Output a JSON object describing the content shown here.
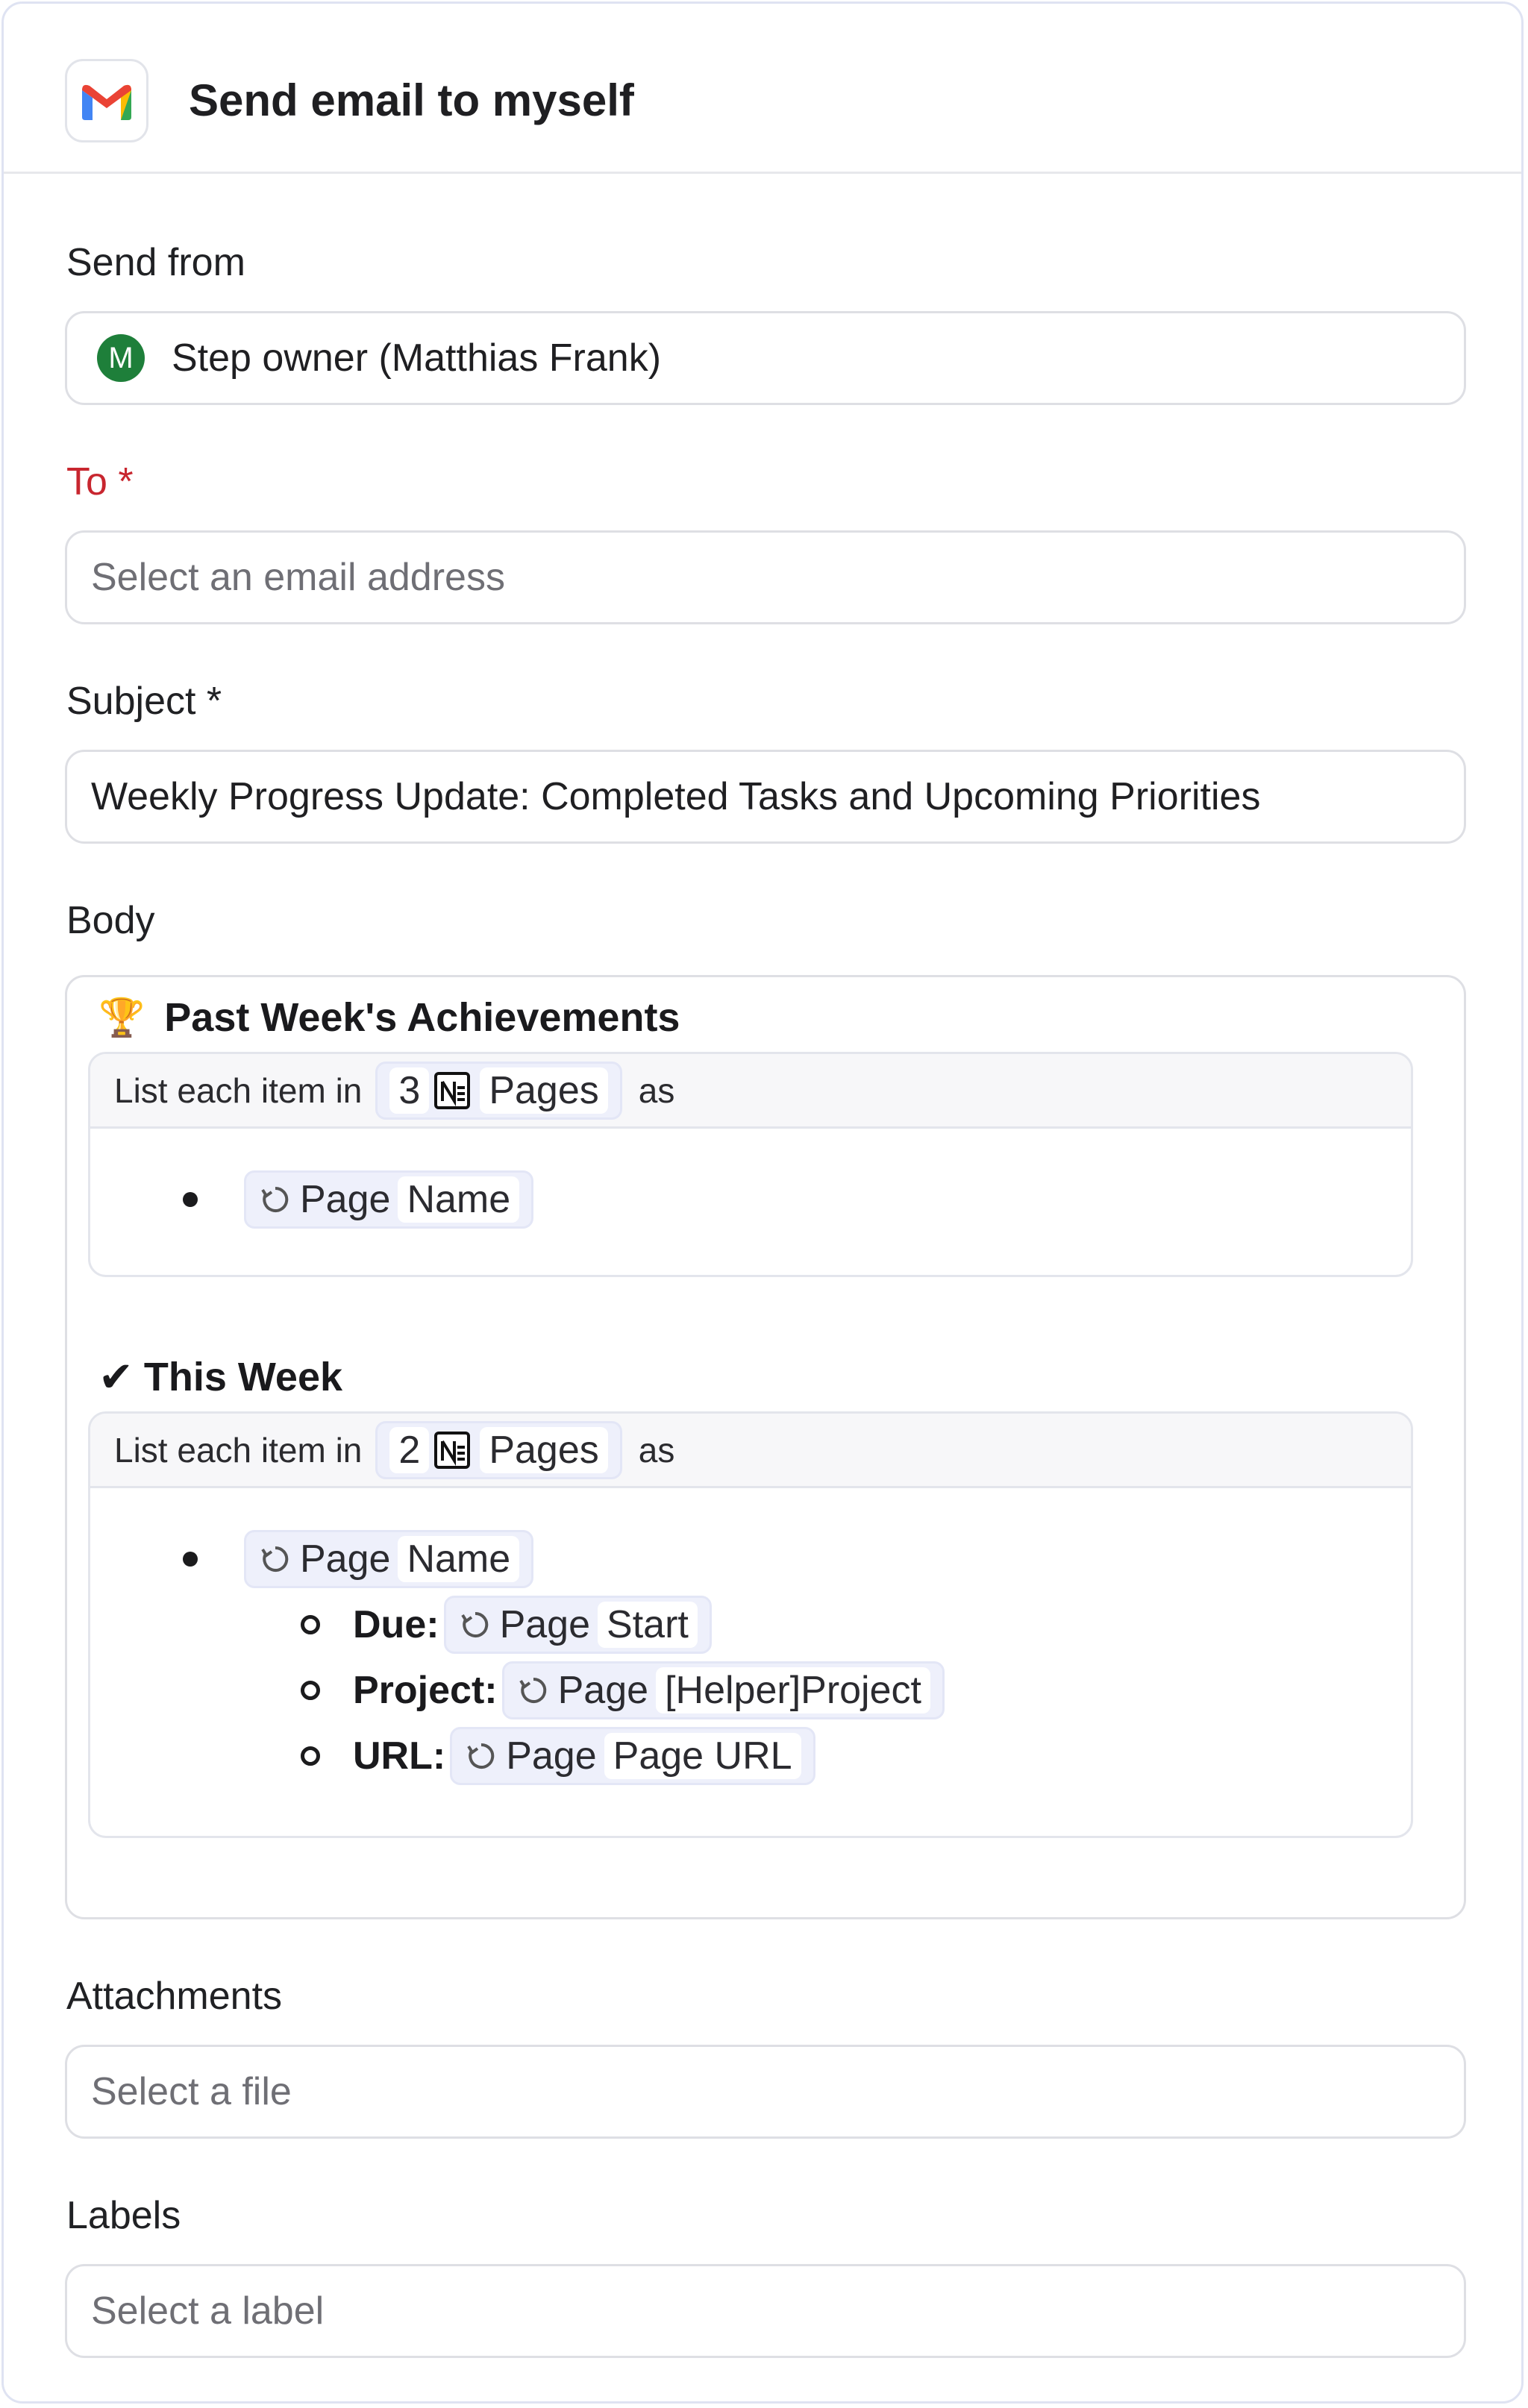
{
  "header": {
    "title": "Send email to myself",
    "app_icon": "gmail-icon"
  },
  "send_from": {
    "label": "Send from",
    "avatar_initial": "M",
    "value": "Step owner (Matthias Frank)"
  },
  "to": {
    "label": "To *",
    "placeholder": "Select an email address"
  },
  "subject": {
    "label": "Subject *",
    "value": "Weekly Progress Update: Completed Tasks and Upcoming Priorities"
  },
  "body": {
    "label": "Body",
    "sections": [
      {
        "emoji": "🏆",
        "heading": "Past Week's Achievements",
        "loop": {
          "prefix": "List each item in",
          "count": "3",
          "source": "Pages",
          "suffix": "as"
        },
        "item": {
          "var": "Page",
          "field": "Name"
        }
      },
      {
        "emoji": "✔",
        "heading": "This Week",
        "loop": {
          "prefix": "List each item in",
          "count": "2",
          "source": "Pages",
          "suffix": "as"
        },
        "item": {
          "var": "Page",
          "field": "Name"
        },
        "subitems": [
          {
            "label": "Due:",
            "var": "Page",
            "field": "Start"
          },
          {
            "label": "Project:",
            "var": "Page",
            "field": "[Helper]Project"
          },
          {
            "label": "URL:",
            "var": "Page",
            "field": "Page URL"
          }
        ]
      }
    ]
  },
  "attachments": {
    "label": "Attachments",
    "placeholder": "Select a file"
  },
  "labels": {
    "label": "Labels",
    "placeholder": "Select a label"
  },
  "colors": {
    "required": "#c8262f",
    "avatar": "#1e7f3a",
    "chip_bg": "#eef0fb",
    "border": "#dedfe4"
  }
}
